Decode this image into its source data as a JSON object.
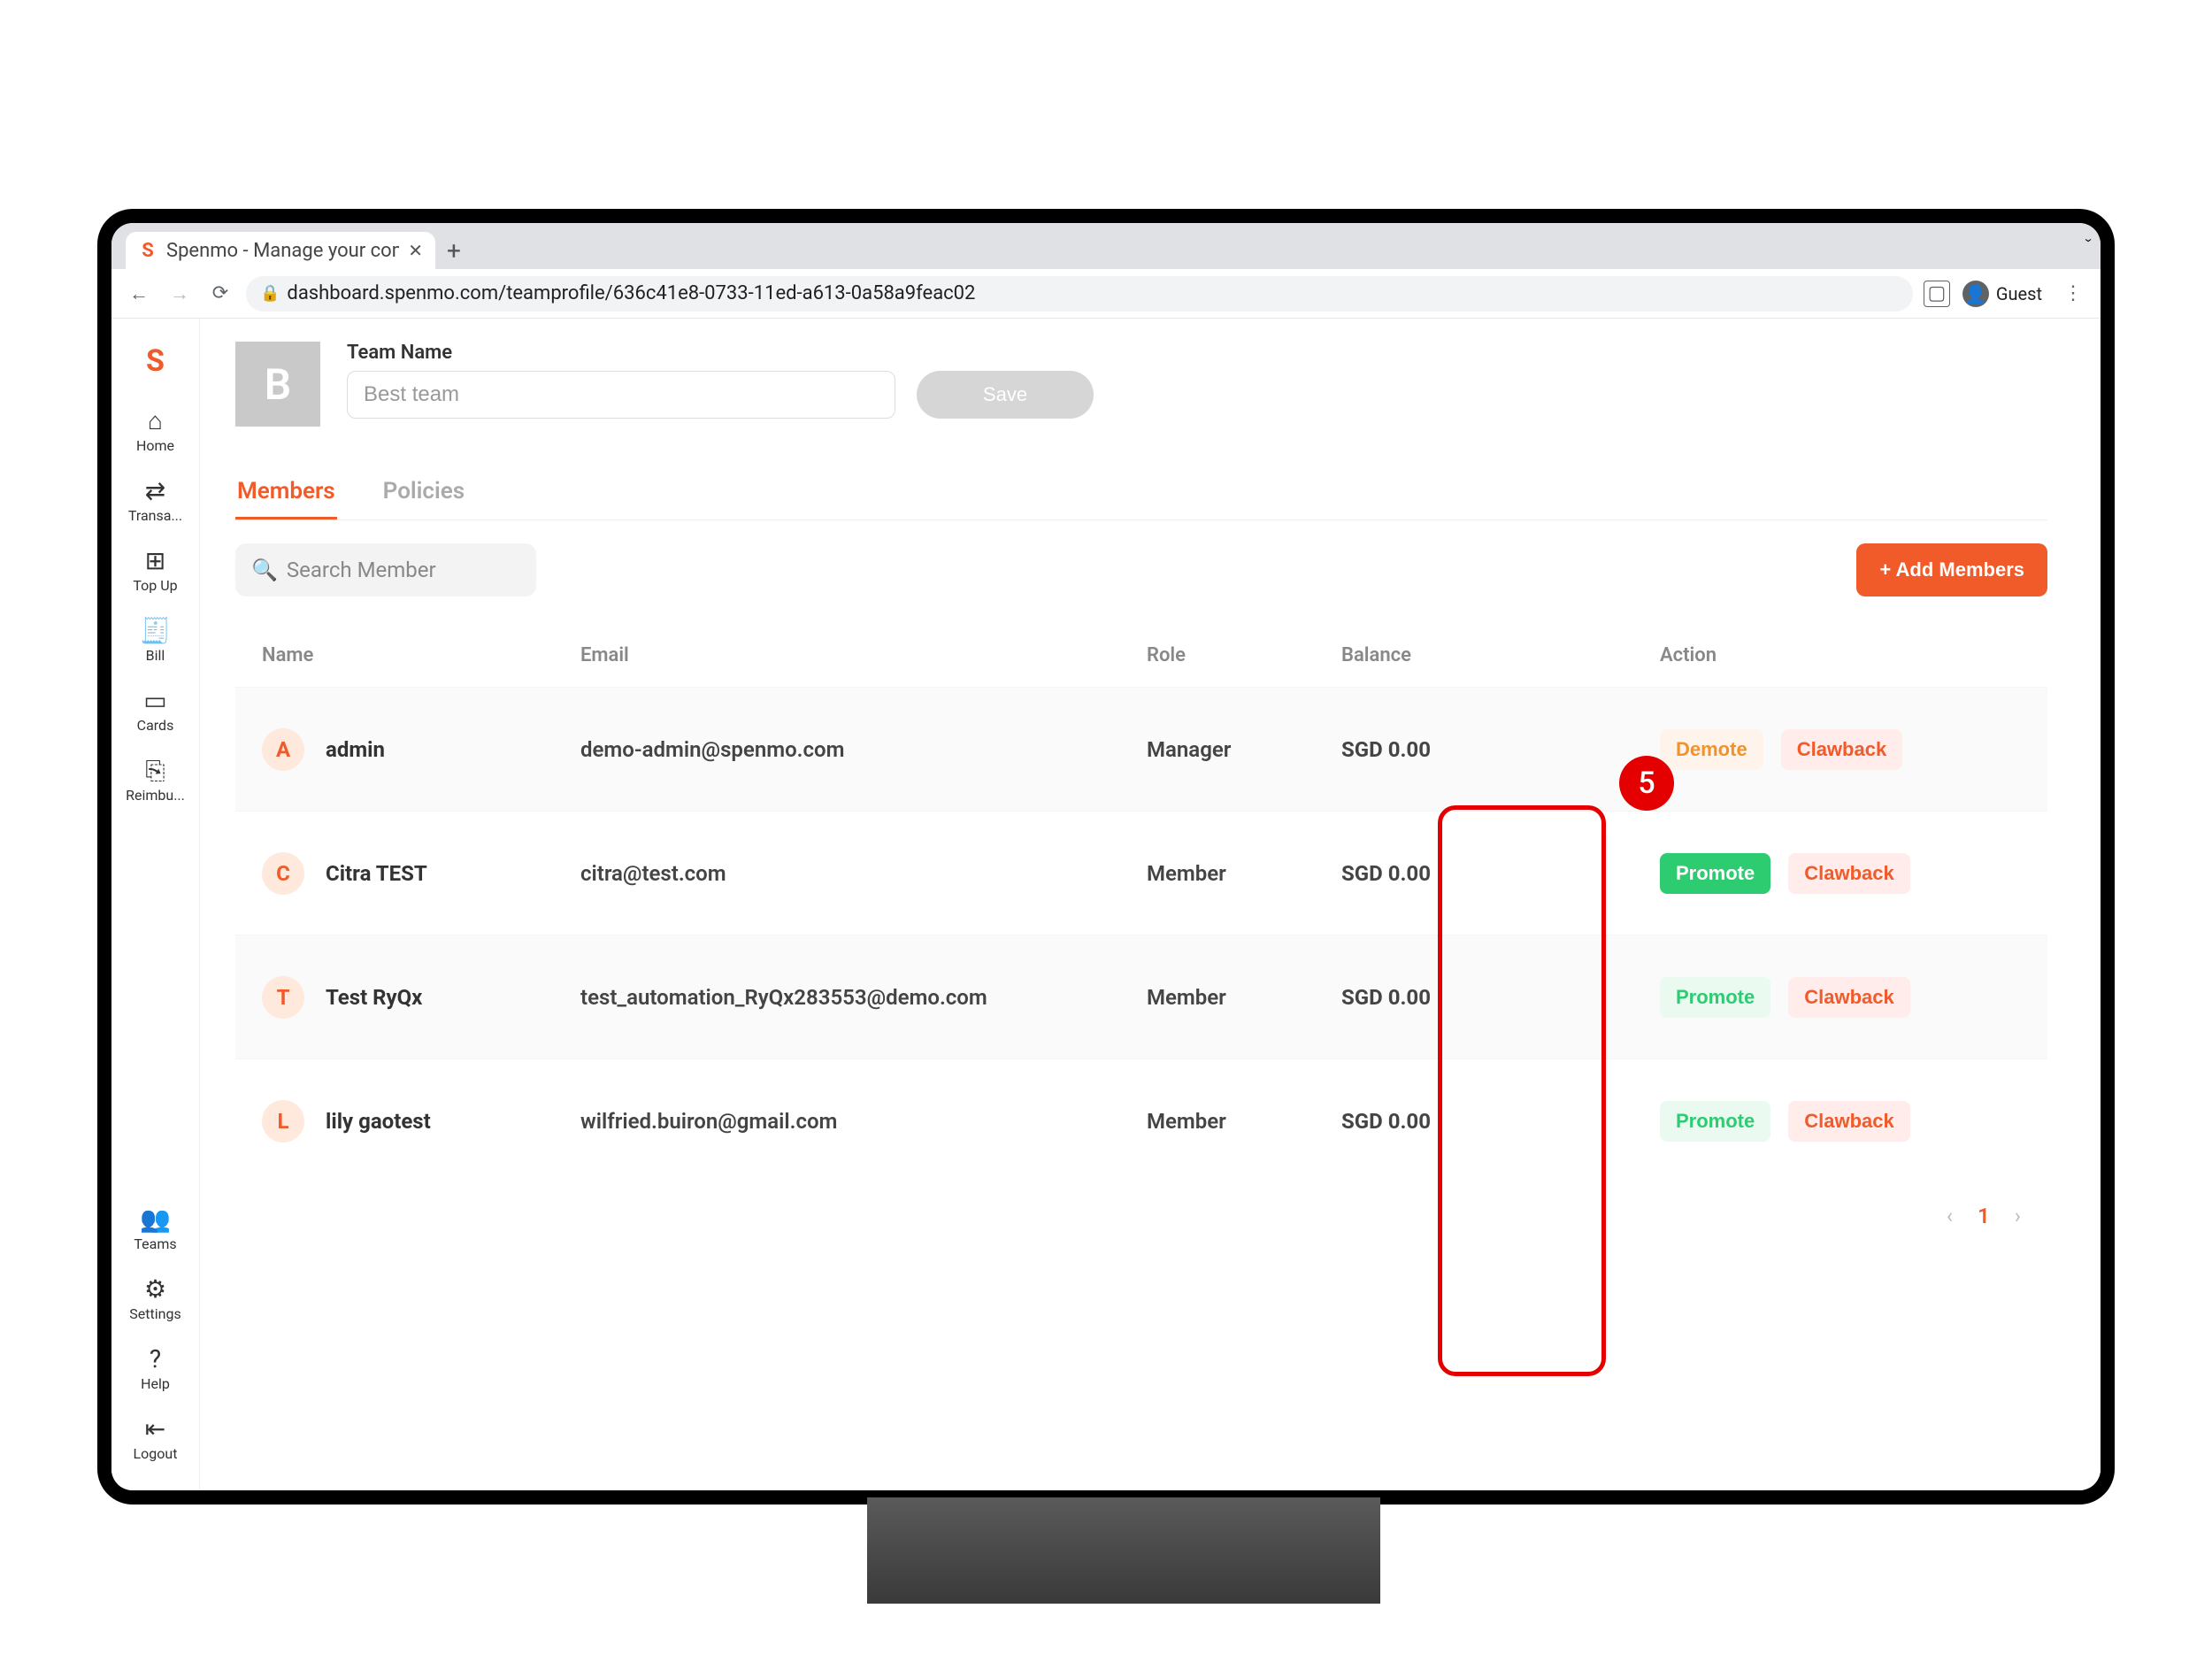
{
  "browser": {
    "tab_title": "Spenmo - Manage your compa",
    "url": "dashboard.spenmo.com/teamprofile/636c41e8-0733-11ed-a613-0a58a9feac02",
    "guest_label": "Guest"
  },
  "sidebar": {
    "items": [
      {
        "label": "Home",
        "icon": "⌂"
      },
      {
        "label": "Transa...",
        "icon": "⇄"
      },
      {
        "label": "Top Up",
        "icon": "⊞"
      },
      {
        "label": "Bill",
        "icon": "🧾"
      },
      {
        "label": "Cards",
        "icon": "▭"
      },
      {
        "label": "Reimbu...",
        "icon": "⎘"
      }
    ],
    "bottom": [
      {
        "label": "Teams",
        "icon": "👥"
      },
      {
        "label": "Settings",
        "icon": "⚙"
      },
      {
        "label": "Help",
        "icon": "?"
      },
      {
        "label": "Logout",
        "icon": "⇤"
      }
    ]
  },
  "team": {
    "avatar_letter": "B",
    "name_label": "Team Name",
    "name_value": "Best team",
    "save_label": "Save"
  },
  "tabs": {
    "members": "Members",
    "policies": "Policies"
  },
  "toolbar": {
    "search_placeholder": "Search Member",
    "add_label": "+ Add Members"
  },
  "table": {
    "columns": {
      "name": "Name",
      "email": "Email",
      "role": "Role",
      "balance": "Balance",
      "action": "Action"
    },
    "rows": [
      {
        "initial": "A",
        "name": "admin",
        "email": "demo-admin@spenmo.com",
        "role": "Manager",
        "balance": "SGD 0.00",
        "actions": [
          "Demote",
          "Clawback"
        ],
        "promote_style": "demote"
      },
      {
        "initial": "C",
        "name": "Citra TEST",
        "email": "citra@test.com",
        "role": "Member",
        "balance": "SGD 0.00",
        "actions": [
          "Promote",
          "Clawback"
        ],
        "promote_style": "green"
      },
      {
        "initial": "T",
        "name": "Test RyQx",
        "email": "test_automation_RyQx283553@demo.com",
        "role": "Member",
        "balance": "SGD 0.00",
        "actions": [
          "Promote",
          "Clawback"
        ],
        "promote_style": "soft"
      },
      {
        "initial": "L",
        "name": "lily gaotest",
        "email": "wilfried.buiron@gmail.com",
        "role": "Member",
        "balance": "SGD 0.00",
        "actions": [
          "Promote",
          "Clawback"
        ],
        "promote_style": "soft"
      }
    ]
  },
  "pagination": {
    "current": "1"
  },
  "annotation": {
    "number": "5"
  }
}
